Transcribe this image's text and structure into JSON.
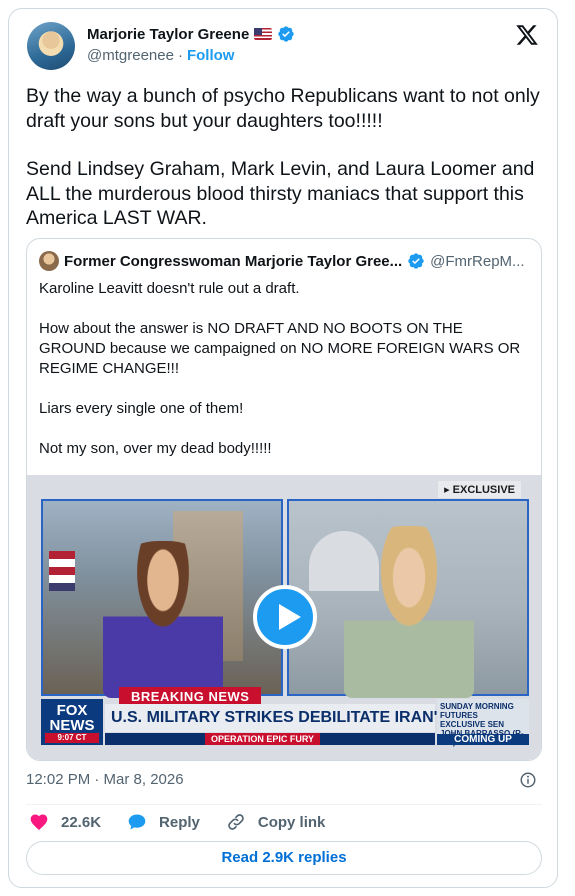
{
  "author": {
    "name": "Marjorie Taylor Greene",
    "handle": "@mtgreenee",
    "separator": "·",
    "follow_label": "Follow"
  },
  "tweet": {
    "paragraphs": [
      "By the way a bunch of psycho Republicans want to not only draft your sons but your daughters too!!!!!",
      "Send Lindsey Graham, Mark Levin, and Laura Loomer and ALL the murderous blood thirsty maniacs that support this America LAST WAR."
    ],
    "timestamp": "12:02 PM · Mar 8, 2026"
  },
  "quoted": {
    "name": "Former Congresswoman Marjorie Taylor Gree...",
    "handle": "@FmrRepM...",
    "paragraphs": [
      "Karoline Leavitt doesn't rule out a draft.",
      "How about the answer is NO DRAFT AND NO BOOTS ON THE GROUND because we campaigned on NO MORE FOREIGN WARS OR REGIME CHANGE!!!",
      "Liars every single one of them!",
      "Not my son, over my dead body!!!!!"
    ],
    "video": {
      "exclusive": "▸ EXCLUSIVE",
      "breaking": "BREAKING NEWS",
      "network_line1": "FOX",
      "network_line2": "NEWS",
      "clock": "9:07 CT",
      "headline": "U.S. MILITARY STRIKES DEBILITATE IRAN'S REGIME",
      "operation": "OPERATION EPIC FURY",
      "promo_title": "SUNDAY MORNING FUTURES",
      "promo_sub": "EXCLUSIVE SEN JOHN BARRASSO (R-WY)",
      "promo_coming": "COMING UP"
    }
  },
  "actions": {
    "likes": "22.6K",
    "reply_label": "Reply",
    "copy_label": "Copy link",
    "read_replies": "Read 2.9K replies"
  },
  "colors": {
    "accent": "#1d9bf0",
    "like": "#f91880",
    "muted": "#536471"
  }
}
